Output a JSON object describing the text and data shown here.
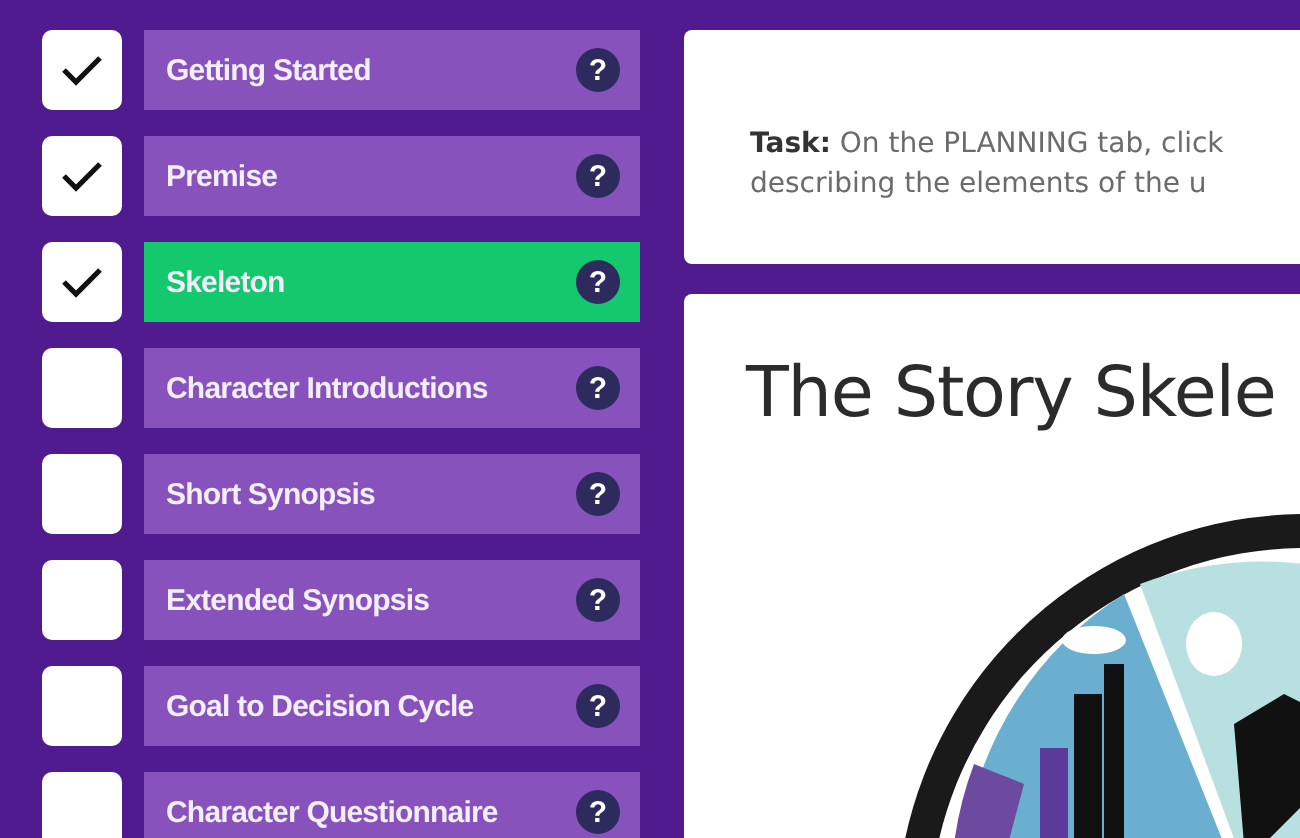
{
  "steps": [
    {
      "label": "Getting Started",
      "checked": true,
      "selected": false,
      "help": "?"
    },
    {
      "label": "Premise",
      "checked": true,
      "selected": false,
      "help": "?"
    },
    {
      "label": "Skeleton",
      "checked": true,
      "selected": true,
      "help": "?"
    },
    {
      "label": "Character Introductions",
      "checked": false,
      "selected": false,
      "help": "?"
    },
    {
      "label": "Short Synopsis",
      "checked": false,
      "selected": false,
      "help": "?"
    },
    {
      "label": "Extended Synopsis",
      "checked": false,
      "selected": false,
      "help": "?"
    },
    {
      "label": "Goal to Decision Cycle",
      "checked": false,
      "selected": false,
      "help": "?"
    },
    {
      "label": "Character Questionnaire",
      "checked": false,
      "selected": false,
      "help": "?"
    }
  ],
  "task": {
    "text": "**Task:** On the PLANNING tab, click\ndescribing the elements of the u"
  },
  "content": {
    "title": "The Story Skele"
  }
}
